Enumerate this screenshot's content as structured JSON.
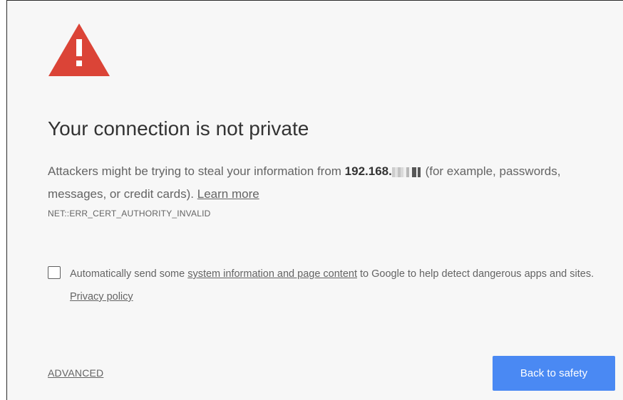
{
  "page": {
    "title": "Your connection is not private",
    "description_prefix": "Attackers might be trying to steal your information from ",
    "host_visible": "192.168.",
    "description_suffix": " (for example, passwords, messages, or credit cards). ",
    "learn_more_link": "Learn more",
    "error_code": "NET::ERR_CERT_AUTHORITY_INVALID"
  },
  "report": {
    "checkbox_checked": false,
    "text_prefix": "Automatically send some ",
    "system_info_link": "system information and page content",
    "text_middle": " to Google to help detect dangerous apps and sites. ",
    "privacy_link": "Privacy policy"
  },
  "actions": {
    "advanced_link": "ADVANCED",
    "back_button": "Back to safety"
  },
  "colors": {
    "warning_icon": "#db4437",
    "primary_button": "#4a89f3",
    "background": "#f7f7f7"
  },
  "icons": {
    "warning": "warning-triangle-icon"
  }
}
